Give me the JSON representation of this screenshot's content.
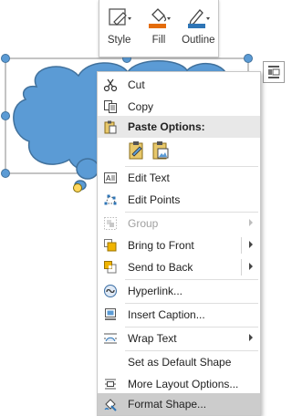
{
  "toolbar": {
    "style_label": "Style",
    "fill_label": "Fill",
    "outline_label": "Outline",
    "fill_color": "#e46c0a",
    "outline_color": "#2e75b6"
  },
  "shape": {
    "fill_color": "#5b9bd5",
    "stroke_color": "#41719c"
  },
  "menu": {
    "cut": "Cut",
    "copy": "Copy",
    "paste_options": "Paste Options:",
    "edit_text": "Edit Text",
    "edit_points": "Edit Points",
    "group": "Group",
    "bring_to_front": "Bring to Front",
    "send_to_back": "Send to Back",
    "hyperlink": "Hyperlink...",
    "insert_caption": "Insert Caption...",
    "wrap_text": "Wrap Text",
    "set_default_shape": "Set as Default Shape",
    "more_layout_options": "More Layout Options...",
    "format_shape": "Format Shape..."
  },
  "icons": {
    "cut": "scissors-icon",
    "copy": "copy-icon",
    "paste": "clipboard-icon",
    "edit_text": "edit-text-icon",
    "edit_points": "edit-points-icon",
    "group": "group-icon",
    "bring_to_front": "bring-to-front-icon",
    "send_to_back": "send-to-back-icon",
    "hyperlink": "link-icon",
    "insert_caption": "caption-icon",
    "wrap_text": "wrap-text-icon",
    "more_layout_options": "layout-options-icon",
    "format_shape": "format-shape-icon"
  }
}
